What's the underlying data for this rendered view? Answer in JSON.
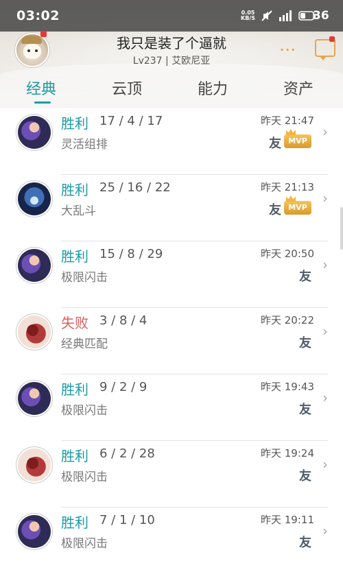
{
  "status": {
    "time": "03:02",
    "net_speed_value": "0.05",
    "net_speed_unit": "KB/S",
    "battery": "36"
  },
  "profile": {
    "name": "我只是装了个逼就",
    "level": "Lv237 | 艾欧尼亚",
    "more": "···"
  },
  "tabs": [
    {
      "label": "经典",
      "active": true
    },
    {
      "label": "云顶",
      "active": false
    },
    {
      "label": "能力",
      "active": false
    },
    {
      "label": "资产",
      "active": false
    }
  ],
  "matches": [
    {
      "result": "胜利",
      "outcome": "win",
      "kda": "17 / 4 / 17",
      "mode": "灵活组排",
      "time": "昨天 21:47",
      "friend": "友",
      "mvp": "MVP",
      "has_mvp": true,
      "champion": "purple-hair"
    },
    {
      "result": "胜利",
      "outcome": "win",
      "kda": "25 / 16 / 22",
      "mode": "大乱斗",
      "time": "昨天 21:13",
      "friend": "友",
      "mvp": "MVP",
      "has_mvp": true,
      "champion": "hooded-blue"
    },
    {
      "result": "胜利",
      "outcome": "win",
      "kda": "15 / 8 / 29",
      "mode": "极限闪击",
      "time": "昨天 20:50",
      "friend": "友",
      "mvp": "",
      "has_mvp": false,
      "champion": "purple-hair"
    },
    {
      "result": "失败",
      "outcome": "loss",
      "kda": "3 / 8 / 4",
      "mode": "经典匹配",
      "time": "昨天 20:22",
      "friend": "友",
      "mvp": "",
      "has_mvp": false,
      "champion": "red-beast"
    },
    {
      "result": "胜利",
      "outcome": "win",
      "kda": "9 / 2 / 9",
      "mode": "极限闪击",
      "time": "昨天 19:43",
      "friend": "友",
      "mvp": "",
      "has_mvp": false,
      "champion": "purple-hair"
    },
    {
      "result": "胜利",
      "outcome": "win",
      "kda": "6 / 2 / 28",
      "mode": "极限闪击",
      "time": "昨天 19:24",
      "friend": "友",
      "mvp": "",
      "has_mvp": false,
      "champion": "red-beast"
    },
    {
      "result": "胜利",
      "outcome": "win",
      "kda": "7 / 1 / 10",
      "mode": "极限闪击",
      "time": "昨天 19:11",
      "friend": "友",
      "mvp": "",
      "has_mvp": false,
      "champion": "purple-hair"
    }
  ],
  "colors": {
    "accent": "#1a9ba6",
    "loss": "#e05d5d",
    "mvp": "#f2b53d",
    "icon_orange": "#e8a44a"
  }
}
